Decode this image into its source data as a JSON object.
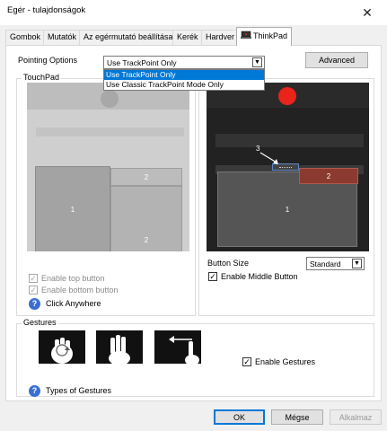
{
  "window": {
    "title": "Egér - tulajdonságok",
    "close_glyph": "✕"
  },
  "tabs": [
    {
      "label": "Gombok"
    },
    {
      "label": "Mutatók"
    },
    {
      "label": "Az egérmutató beállításai"
    },
    {
      "label": "Kerék"
    },
    {
      "label": "Hardver"
    },
    {
      "label": "ThinkPad",
      "active": true
    }
  ],
  "pointing": {
    "label": "Pointing Options",
    "selected": "Use TrackPoint Only",
    "options": [
      "Use TrackPoint Only",
      "Use Classic TrackPoint Mode Only"
    ],
    "advanced_label": "Advanced"
  },
  "touchpad": {
    "group_label": "TouchPad",
    "areas": {
      "main": "1",
      "top_right": "2",
      "bottom_right": "2"
    },
    "enable_top_button": "Enable top button",
    "enable_bottom_button": "Enable bottom button",
    "click_anywhere": "Click Anywhere"
  },
  "trackpoint": {
    "labels": {
      "area1": "1",
      "area2": "2",
      "area3": "3"
    },
    "button_size_label": "Button Size",
    "button_size_value": "Standard",
    "enable_middle_button": "Enable Middle Button",
    "accent_red": "#e8241b"
  },
  "gestures": {
    "group_label": "Gestures",
    "enable_gestures": "Enable Gestures",
    "types_link": "Types of Gestures"
  },
  "footer": {
    "ok": "OK",
    "cancel": "Mégse",
    "apply": "Alkalmaz"
  },
  "check_glyph": "✓",
  "help_glyph": "?",
  "arrow_glyph": "▼"
}
